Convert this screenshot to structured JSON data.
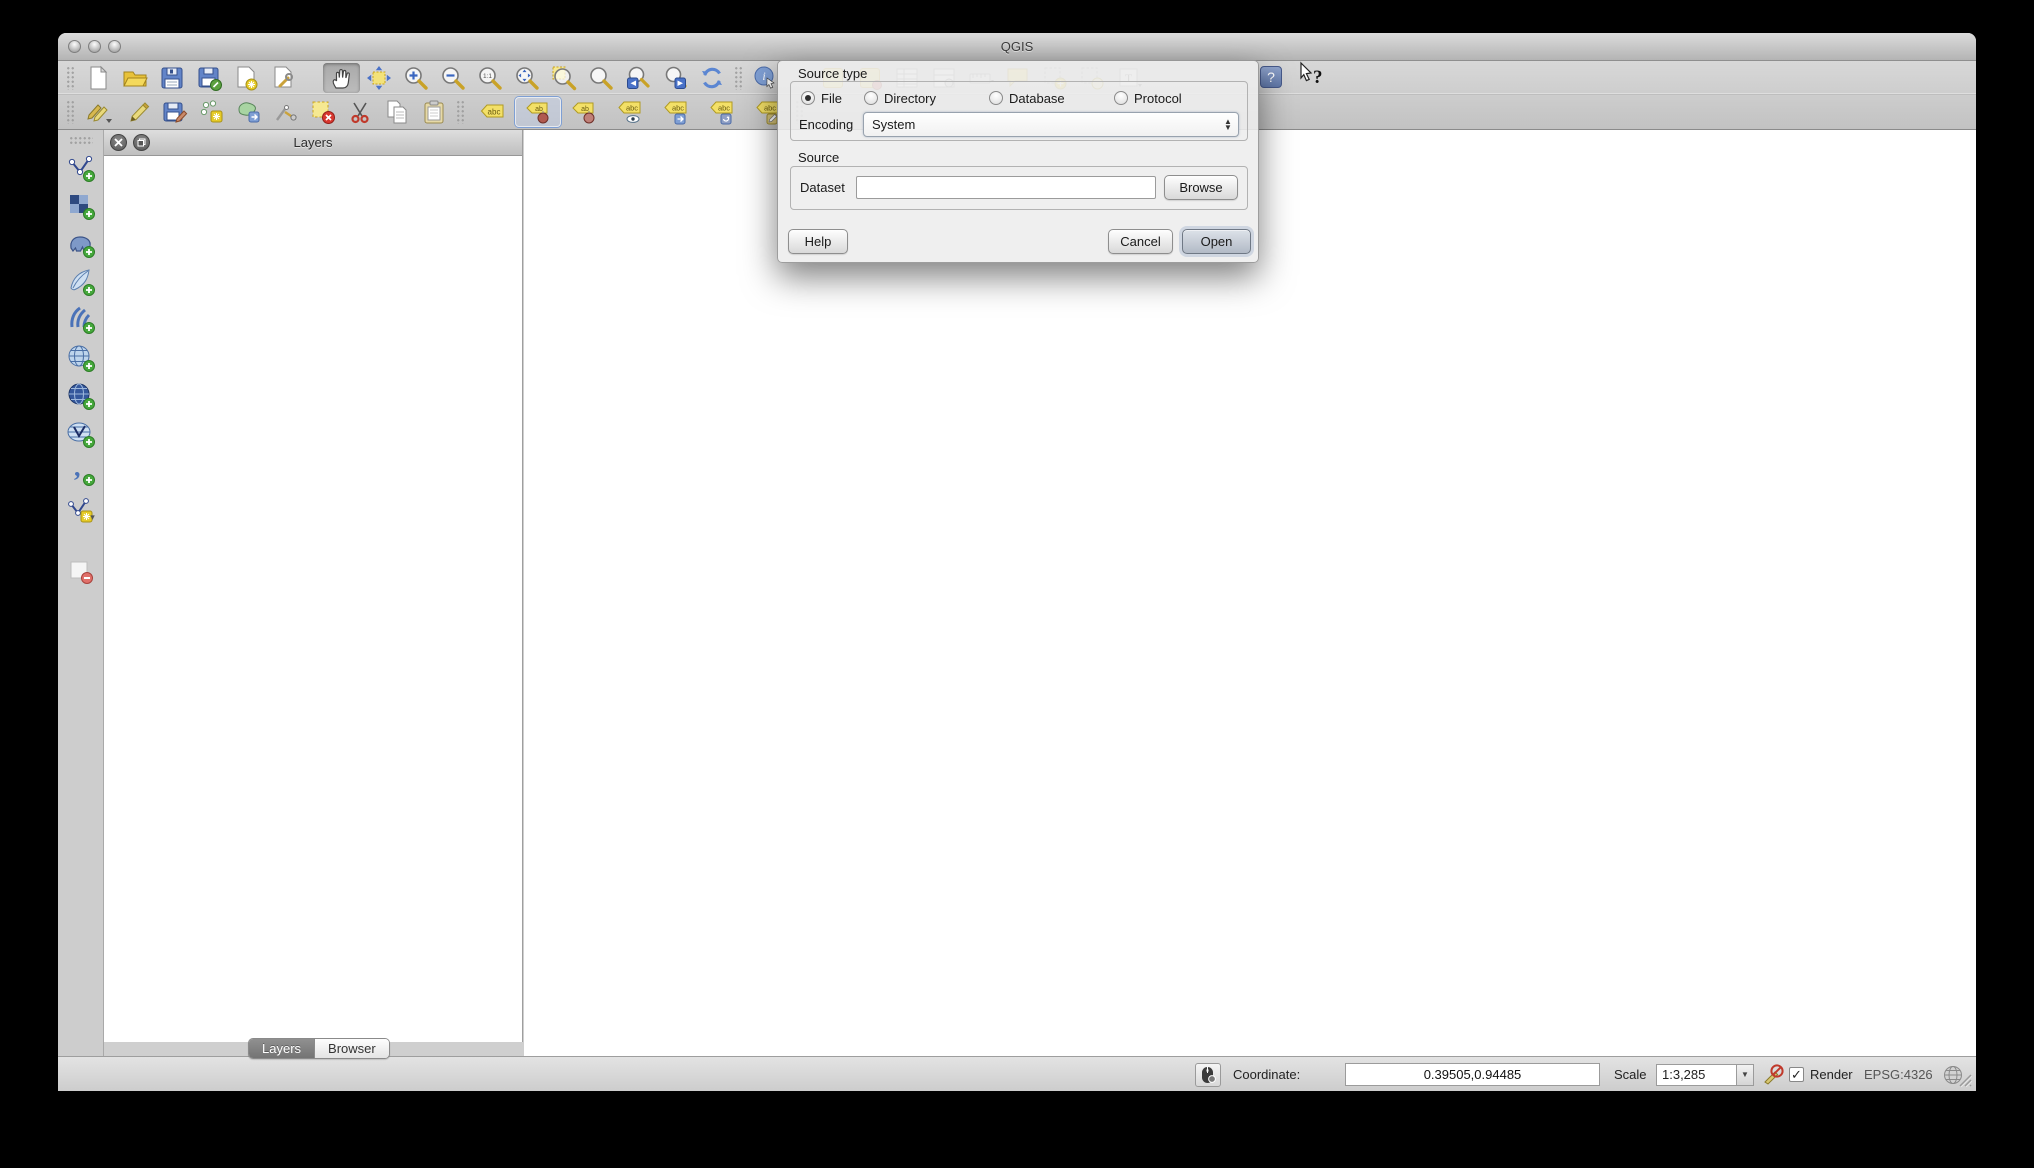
{
  "window": {
    "title": "QGIS"
  },
  "icons": {
    "titlebar": [
      "close",
      "minimize",
      "zoom"
    ],
    "toolbar_row1": [
      "new-project",
      "open-project",
      "save-project",
      "save-project-as",
      "new-print-composer",
      "composer-manager",
      "pan-map",
      "pan-to-selection",
      "zoom-in",
      "zoom-out",
      "zoom-actual-size",
      "zoom-full-extent",
      "zoom-to-selection",
      "zoom-to-layer",
      "zoom-last",
      "zoom-next",
      "refresh",
      "identify-features",
      "help"
    ],
    "toolbar_row2": [
      "current-edits",
      "toggle-editing",
      "save-edits",
      "add-feature",
      "move-feature",
      "node-tool",
      "delete-selected",
      "cut-features",
      "copy-features",
      "paste-features",
      "labeling",
      "label-pin-selected",
      "label-pin",
      "label-show-hide",
      "label-move",
      "label-rotate",
      "label-change"
    ],
    "left_toolbar": [
      "add-vector-layer",
      "add-raster-layer",
      "add-postgis-layer",
      "add-spatialite-layer",
      "add-mssql-layer",
      "add-wms-layer",
      "add-wcs-layer",
      "add-wfs-layer",
      "add-delimited-text-layer",
      "new-shapefile-layer",
      "remove-layer"
    ],
    "panel_header": [
      "close",
      "float"
    ],
    "statusbar": [
      "mouse-tracking",
      "stop-render",
      "crs-globe",
      "resize-grip"
    ],
    "cursor": "whats-this-arrow"
  },
  "dialog": {
    "source_type_label": "Source type",
    "radios": [
      {
        "label": "File",
        "selected": true
      },
      {
        "label": "Directory",
        "selected": false
      },
      {
        "label": "Database",
        "selected": false
      },
      {
        "label": "Protocol",
        "selected": false
      }
    ],
    "encoding_label": "Encoding",
    "encoding_value": "System",
    "source_label": "Source",
    "dataset_label": "Dataset",
    "dataset_value": "",
    "buttons": {
      "browse": "Browse",
      "help": "Help",
      "cancel": "Cancel",
      "open": "Open"
    }
  },
  "layers_panel": {
    "title": "Layers"
  },
  "bottom_tabs": {
    "layers": "Layers",
    "browser": "Browser"
  },
  "statusbar": {
    "coordinate_label": "Coordinate:",
    "coordinate_value": "0.39505,0.94485",
    "scale_label": "Scale",
    "scale_value": "1:3,285",
    "render_label": "Render",
    "crs": "EPSG:4326"
  },
  "colors": {
    "accent_blue": "#5b82c4",
    "folder_yellow": "#e8c23a",
    "selection_yellow": "#f6e992",
    "delete_red": "#d8372f",
    "add_green": "#46a83c"
  }
}
